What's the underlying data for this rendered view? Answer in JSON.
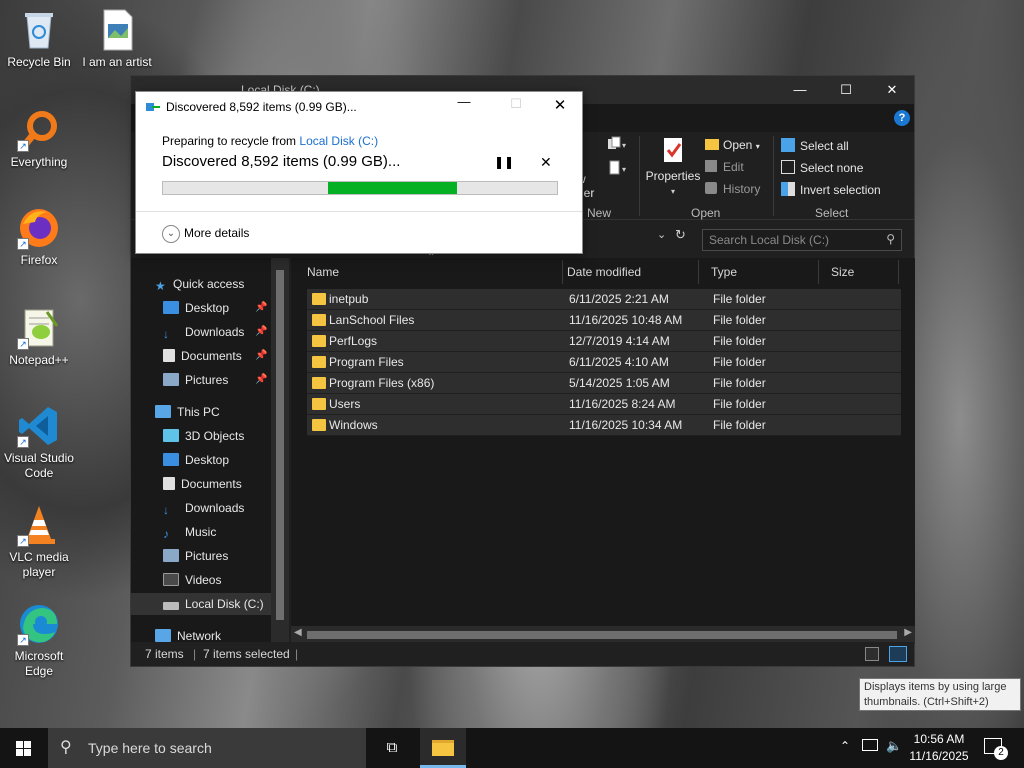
{
  "desktop": {
    "icons": [
      {
        "label": "Recycle Bin",
        "icon": "recycle-bin-icon"
      },
      {
        "label": "I am an artist",
        "icon": "image-file-icon"
      },
      {
        "label": "Everything",
        "icon": "everything-search-icon"
      },
      {
        "label": "Firefox",
        "icon": "firefox-icon"
      },
      {
        "label": "Notepad++",
        "icon": "notepadpp-icon"
      },
      {
        "label": "Visual Studio Code",
        "icon": "vscode-icon"
      },
      {
        "label": "VLC media player",
        "icon": "vlc-icon"
      },
      {
        "label": "Microsoft Edge",
        "icon": "edge-icon"
      }
    ]
  },
  "explorer": {
    "title": "Local Disk (C:)",
    "ribbon": {
      "new_partial": "New",
      "new_folder_partial_1": "w",
      "new_folder_partial_2": "der",
      "properties": "Properties",
      "open": "Open",
      "edit": "Edit",
      "history": "History",
      "select_all": "Select all",
      "select_none": "Select none",
      "invert_selection": "Invert selection",
      "group_new": "New",
      "group_open": "Open",
      "group_select": "Select"
    },
    "search_placeholder": "Search Local Disk (C:)",
    "nav": {
      "quick_access": "Quick access",
      "desktop": "Desktop",
      "downloads": "Downloads",
      "documents": "Documents",
      "pictures": "Pictures",
      "this_pc": "This PC",
      "objects3d": "3D Objects",
      "pc_desktop": "Desktop",
      "pc_documents": "Documents",
      "pc_downloads": "Downloads",
      "music": "Music",
      "pc_pictures": "Pictures",
      "videos": "Videos",
      "local_disk": "Local Disk (C:)",
      "network": "Network"
    },
    "columns": {
      "name": "Name",
      "date": "Date modified",
      "type": "Type",
      "size": "Size"
    },
    "rows": [
      {
        "name": "inetpub",
        "date": "6/11/2025 2:21 AM",
        "type": "File folder"
      },
      {
        "name": "LanSchool Files",
        "date": "11/16/2025 10:48 AM",
        "type": "File folder"
      },
      {
        "name": "PerfLogs",
        "date": "12/7/2019 4:14 AM",
        "type": "File folder"
      },
      {
        "name": "Program Files",
        "date": "6/11/2025 4:10 AM",
        "type": "File folder"
      },
      {
        "name": "Program Files (x86)",
        "date": "5/14/2025 1:05 AM",
        "type": "File folder"
      },
      {
        "name": "Users",
        "date": "11/16/2025 8:24 AM",
        "type": "File folder"
      },
      {
        "name": "Windows",
        "date": "11/16/2025 10:34 AM",
        "type": "File folder"
      }
    ],
    "status": {
      "count": "7 items",
      "selected": "7 items selected"
    }
  },
  "dialog": {
    "title": "Discovered 8,592 items (0.99 GB)...",
    "preparing_prefix": "Preparing to recycle from ",
    "preparing_link": "Local Disk (C:)",
    "headline": "Discovered 8,592 items (0.99 GB)...",
    "more_details": "More details",
    "progress_start": 0.42,
    "progress_end": 0.745
  },
  "tooltip": {
    "line1": "Displays items by using large",
    "line2": "thumbnails.  (Ctrl+Shift+2)"
  },
  "taskbar": {
    "search_placeholder": "Type here to search",
    "time": "10:56 AM",
    "date": "11/16/2025",
    "notification_count": "2"
  },
  "colors": {
    "accent": "#1a78d2",
    "progress": "#06b025",
    "folder": "#f5c542"
  }
}
